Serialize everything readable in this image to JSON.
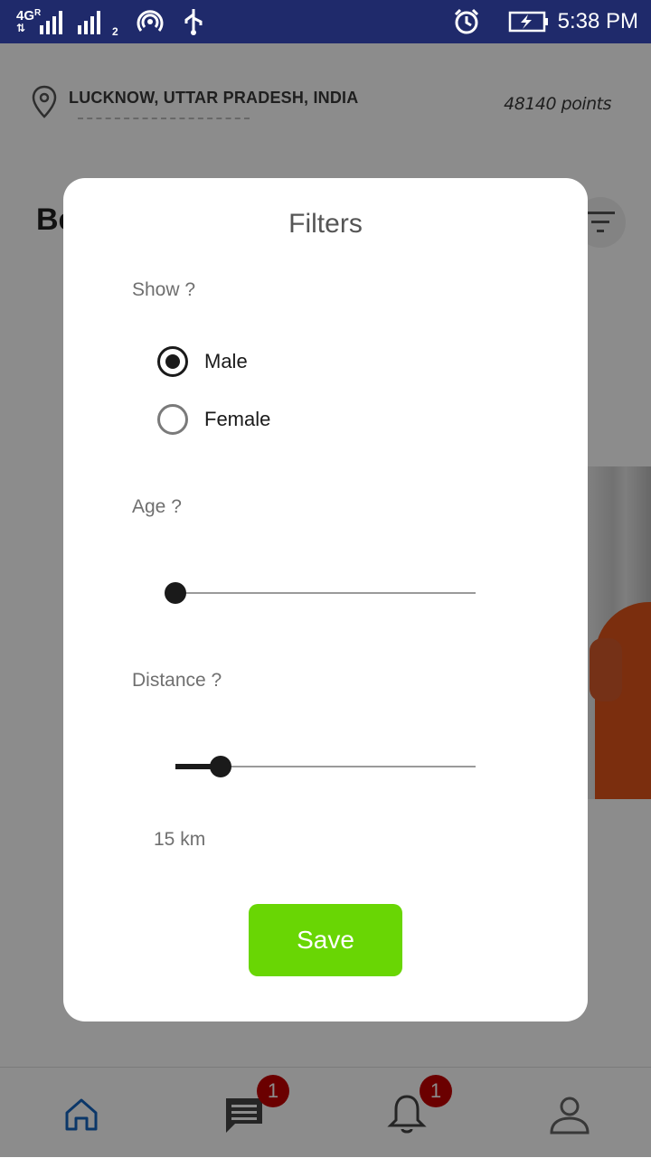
{
  "status_bar": {
    "network": "4G",
    "network_sub": "R",
    "sim2_label": "2",
    "time": "5:38 PM",
    "icons": [
      "signal-icon",
      "hotspot-icon",
      "usb-icon",
      "alarm-icon",
      "battery-charging-icon"
    ]
  },
  "header": {
    "location": "LUCKNOW, UTTAR PRADESH, INDIA",
    "location_icon": "map-pin-icon",
    "points": "48140 points"
  },
  "main": {
    "section_title_partial": "Be",
    "filter_icon": "filter-icon"
  },
  "bottom_nav": {
    "items": [
      {
        "icon": "home-icon",
        "active": true
      },
      {
        "icon": "chat-icon",
        "badge": "1"
      },
      {
        "icon": "bell-icon",
        "badge": "1"
      },
      {
        "icon": "profile-icon"
      }
    ],
    "active_color": "#1565c0",
    "badge_color": "#c40000"
  },
  "dialog": {
    "title": "Filters",
    "show_label": "Show ?",
    "gender_options": [
      {
        "label": "Male",
        "selected": true
      },
      {
        "label": "Female",
        "selected": false
      }
    ],
    "age_label": "Age ?",
    "age_slider_fraction": 0.0,
    "distance_label": "Distance ?",
    "distance_slider_fraction": 0.15,
    "distance_value": "15 km",
    "save_label": "Save",
    "save_color": "#69d604"
  }
}
